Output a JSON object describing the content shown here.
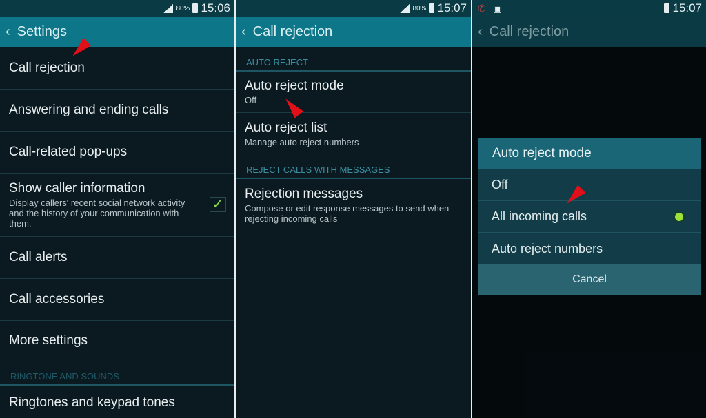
{
  "panel1": {
    "status": {
      "battery": "80%",
      "time": "15:06"
    },
    "title": "Settings",
    "items": [
      {
        "label": "Call rejection"
      },
      {
        "label": "Answering and ending calls"
      },
      {
        "label": "Call-related pop-ups"
      },
      {
        "label": "Show caller information",
        "sub": "Display callers' recent social network activity and the history of your communication with them.",
        "checked": true
      },
      {
        "label": "Call alerts"
      },
      {
        "label": "Call accessories"
      },
      {
        "label": "More settings"
      }
    ],
    "section": "RINGTONE AND SOUNDS",
    "last": "Ringtones and keypad tones"
  },
  "panel2": {
    "status": {
      "battery": "80%",
      "time": "15:07"
    },
    "title": "Call rejection",
    "section1": "AUTO REJECT",
    "mode_label": "Auto reject mode",
    "mode_value": "Off",
    "list_label": "Auto reject list",
    "list_sub": "Manage auto reject numbers",
    "section2": "REJECT CALLS WITH MESSAGES",
    "msg_label": "Rejection messages",
    "msg_sub": "Compose or edit response messages to send when rejecting incoming calls"
  },
  "panel3": {
    "status": {
      "time": "15:07"
    },
    "title": "Call rejection",
    "dialog": {
      "title": "Auto reject mode",
      "options": [
        "Off",
        "All incoming calls",
        "Auto reject numbers"
      ],
      "selected": "All incoming calls",
      "cancel": "Cancel"
    }
  },
  "colors": {
    "action_bar": "#0d7688",
    "radio_selected": "#9ce03a",
    "arrow": "#e0101a"
  }
}
